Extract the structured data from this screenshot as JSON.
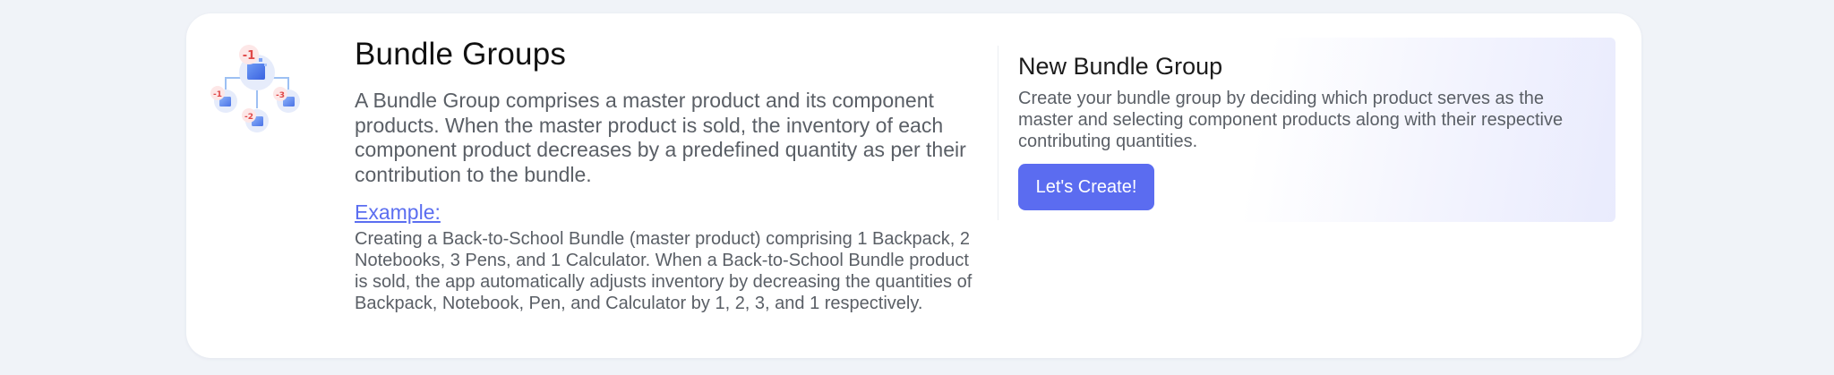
{
  "intro": {
    "title": "Bundle Groups",
    "description": "A Bundle Group comprises a master product and its component products. When the master product is sold, the inventory of each component product decreases by a predefined quantity as per their contribution to the bundle.",
    "example_label": "Example:",
    "example_text": "Creating a Back-to-School Bundle (master product) comprising 1 Backpack, 2 Notebooks, 3 Pens, and 1 Calculator. When a Back-to-School Bundle product is sold, the app automatically adjusts inventory by decreasing the quantities of Backpack, Notebook, Pen, and Calculator by 1, 2, 3, and 1 respectively."
  },
  "illustration": {
    "icon": "bundle-hierarchy-icon",
    "badges": [
      "-1",
      "-1",
      "-2",
      "-3"
    ]
  },
  "cta": {
    "title": "New Bundle Group",
    "description": "Create your bundle group by deciding which product serves as the master and selecting component products along with their respective contributing quantities.",
    "button_label": "Let's Create!"
  },
  "colors": {
    "page_background": "#f0f3f8",
    "card_background": "#ffffff",
    "accent": "#5b6cf0",
    "link": "#5b6ef0",
    "badge_red": "#e04848"
  }
}
